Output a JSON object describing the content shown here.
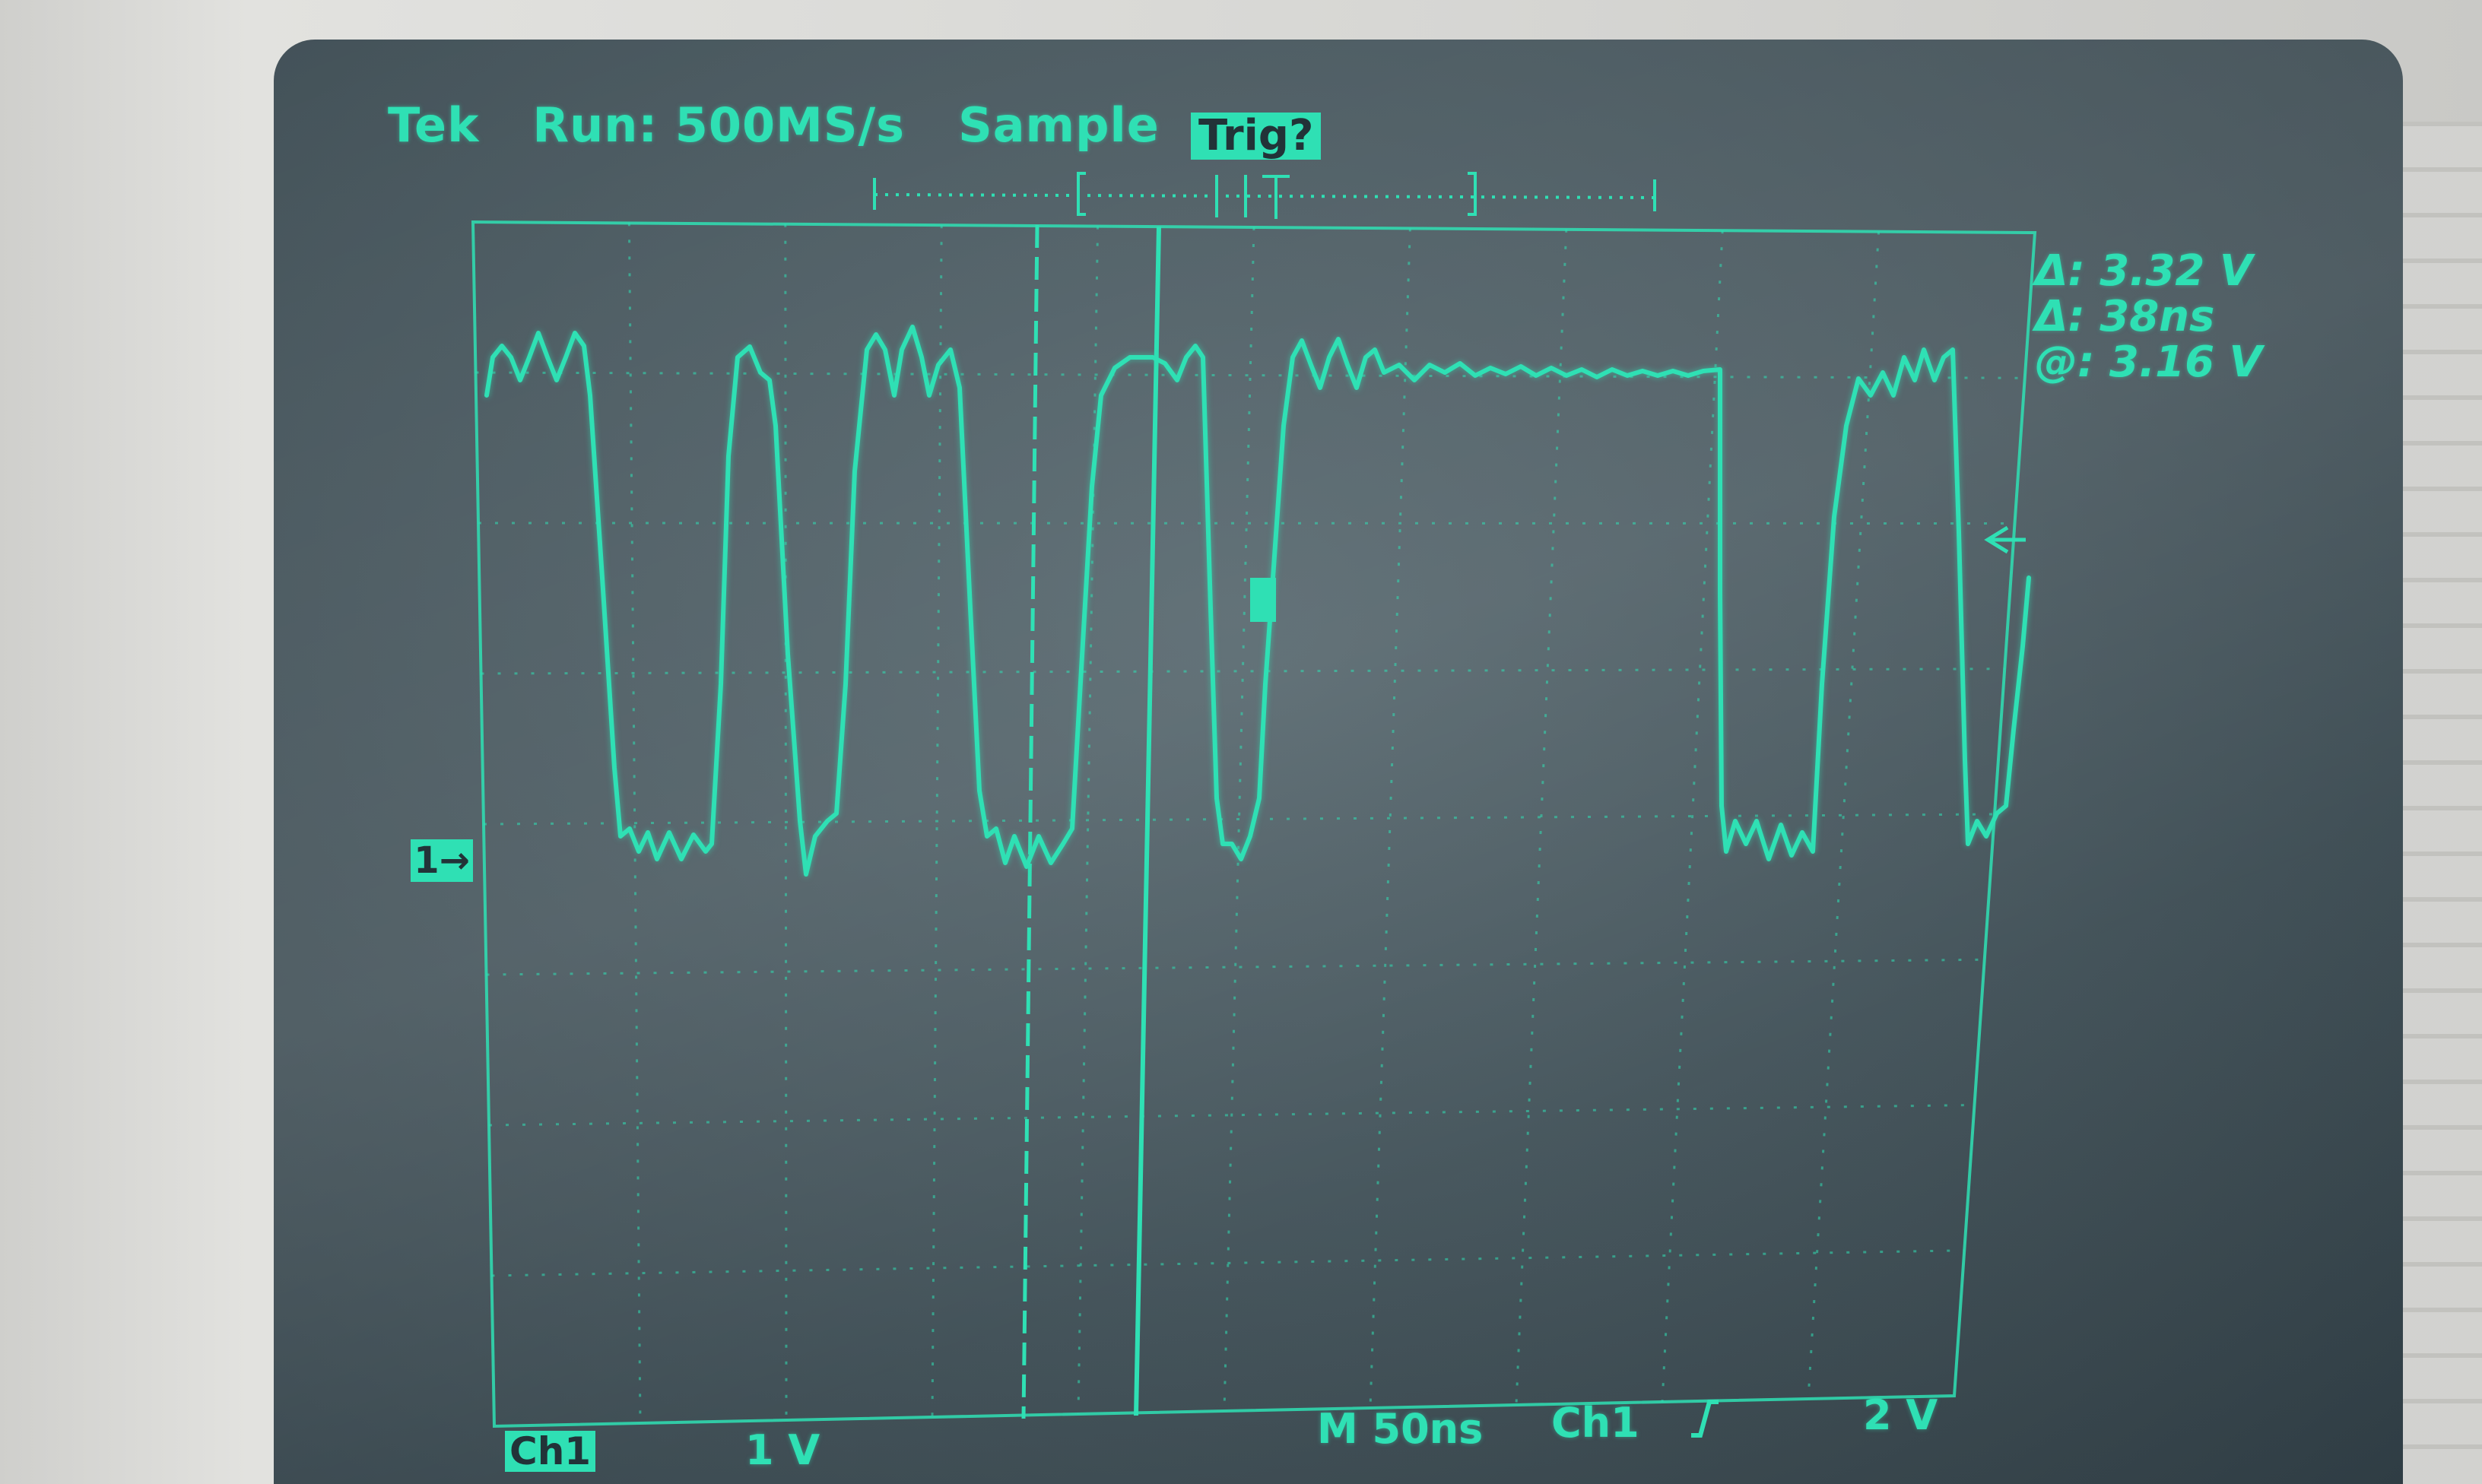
{
  "status": {
    "brand": "Tek",
    "state": "Run: 500MS/s",
    "mode": "Sample",
    "trigger_label": "Trig?"
  },
  "readouts": {
    "delta_voltage": "Δ: 3.32 V",
    "delta_time": "Δ: 38ns",
    "at_voltage": "@: 3.16 V"
  },
  "bottom": {
    "channel": "Ch1",
    "channel_scale": "1 V",
    "timebase": "M 50ns",
    "trigger_source": "Ch1",
    "trigger_slope_icon": "rising-edge-icon",
    "trigger_level": "2 V"
  },
  "markers": {
    "channel_marker": "1→"
  },
  "colors": {
    "trace": "#2fe0b4",
    "screen": "#45555c",
    "bezel": "#d9d9d6"
  }
}
